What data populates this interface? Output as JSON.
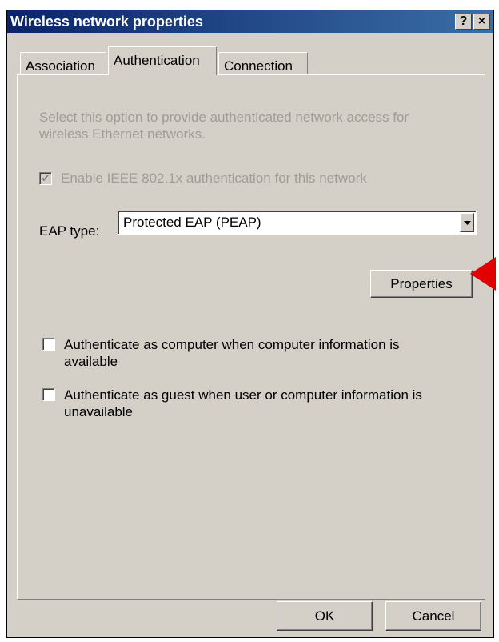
{
  "window": {
    "title": "Wireless network properties",
    "help_label": "?",
    "close_label": "×"
  },
  "tabs": [
    {
      "label": "Association",
      "active": false
    },
    {
      "label": "Authentication",
      "active": true
    },
    {
      "label": "Connection",
      "active": false
    }
  ],
  "auth": {
    "description": "Select this option to provide authenticated network access for wireless Ethernet networks.",
    "enable_label": "Enable IEEE 802.1x authentication for this network",
    "enable_checked": true,
    "eap_label": "EAP type:",
    "eap_value": "Protected EAP (PEAP)",
    "properties_label": "Properties",
    "computer_label": "Authenticate as computer when computer information is available",
    "computer_checked": false,
    "guest_label": "Authenticate as guest when user or computer information is unavailable",
    "guest_checked": false
  },
  "footer": {
    "ok_label": "OK",
    "cancel_label": "Cancel"
  },
  "annotation": {
    "arrow_color": "#e00000"
  }
}
